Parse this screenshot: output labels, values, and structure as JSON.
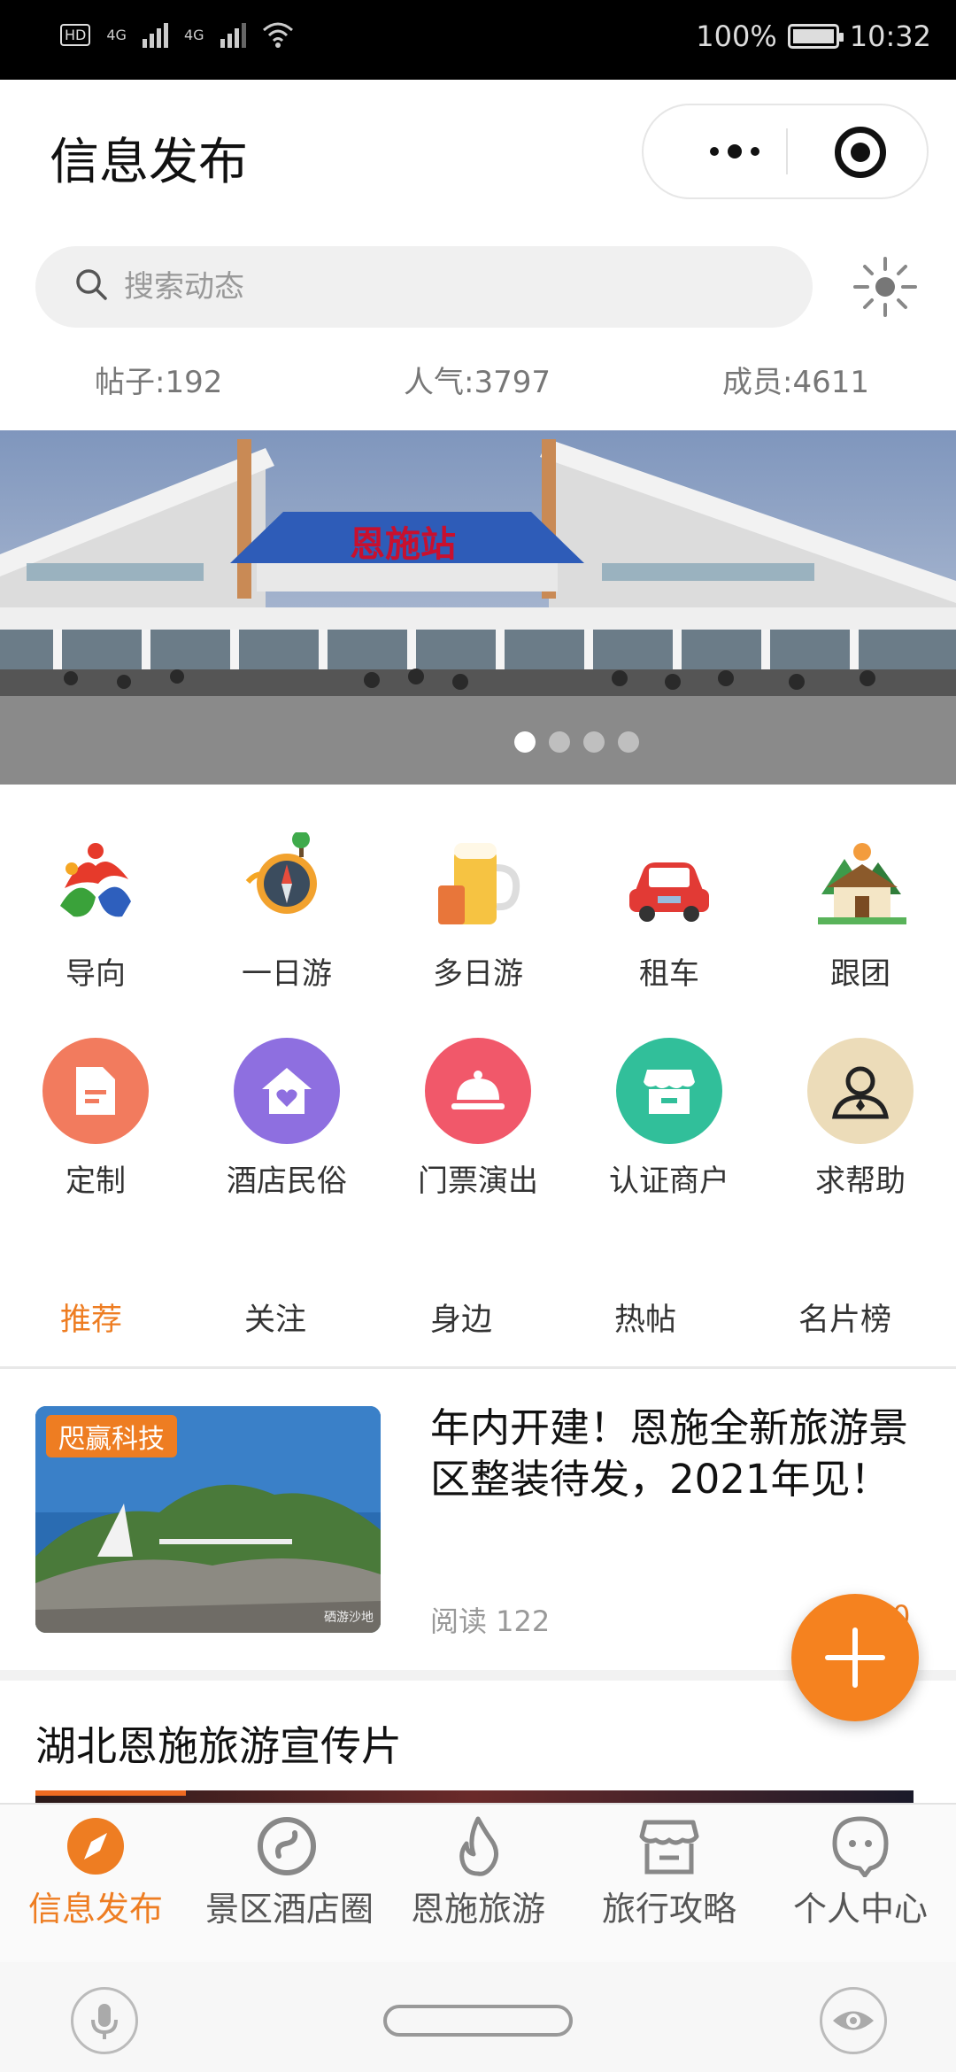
{
  "status_bar": {
    "left_hd": "HD",
    "left_net1": "4G",
    "left_net2": "4G",
    "battery": "100%",
    "time": "10:32"
  },
  "header": {
    "title": "信息发布"
  },
  "search": {
    "placeholder": "搜索动态"
  },
  "stats": {
    "posts": "帖子:192",
    "popularity": "人气:3797",
    "members": "成员:4611"
  },
  "banner": {
    "sign_text": "恩施站",
    "slides": 4,
    "active_slide": 1
  },
  "grid": {
    "row1": [
      "导向",
      "一日游",
      "多日游",
      "租车",
      "跟团"
    ],
    "row2": [
      "定制",
      "酒店民俗",
      "门票演出",
      "认证商户",
      "求帮助"
    ]
  },
  "tabs": [
    {
      "label": "推荐",
      "active": true
    },
    {
      "label": "关注",
      "active": false
    },
    {
      "label": "身边",
      "active": false
    },
    {
      "label": "热帖",
      "active": false
    },
    {
      "label": "名片榜",
      "active": false
    }
  ],
  "feed": {
    "item1": {
      "tag": "咫赢科技",
      "title": "年内开建！恩施全新旅游景区整装待发，2021年见！",
      "read_text": "阅读 122",
      "count": "0",
      "watermark": "硒游沙地"
    },
    "section_title": "湖北恩施旅游宣传片"
  },
  "bottom_nav": [
    {
      "label": "信息发布",
      "icon": "compass-icon",
      "active": true
    },
    {
      "label": "景区酒店圈",
      "icon": "circle-link-icon",
      "active": false
    },
    {
      "label": "恩施旅游",
      "icon": "flame-icon",
      "active": false
    },
    {
      "label": "旅行攻略",
      "icon": "store-icon",
      "active": false
    },
    {
      "label": "个人中心",
      "icon": "ghost-face-icon",
      "active": false
    }
  ],
  "colors": {
    "accent": "#ee7d22",
    "tag_bg": "#ee7d22"
  }
}
